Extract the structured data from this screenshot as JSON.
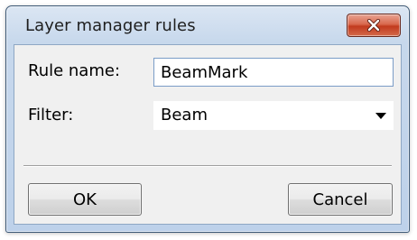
{
  "window": {
    "title": "Layer manager rules",
    "close_icon": "close-icon"
  },
  "form": {
    "rule_name_label": "Rule name:",
    "rule_name_value": "BeamMark",
    "filter_label": "Filter:",
    "filter_value": "Beam",
    "filter_dropdown_icon": "chevron-down-icon"
  },
  "buttons": {
    "ok_label": "OK",
    "cancel_label": "Cancel"
  },
  "colors": {
    "close_button": "#c9452a",
    "frame_border": "#3e5a77",
    "client_background": "#f0f0f0"
  }
}
